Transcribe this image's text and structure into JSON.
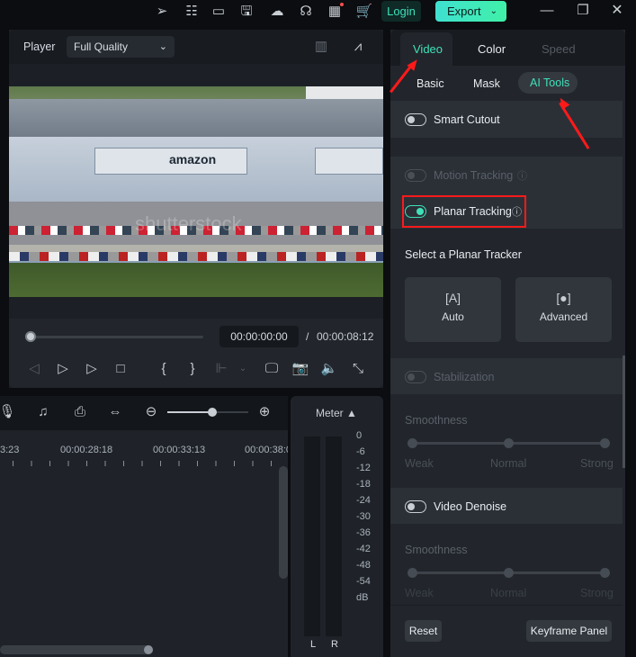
{
  "topbar": {
    "icons": [
      "send-icon",
      "task-icon",
      "layout-icon",
      "save-icon",
      "cloud-icon",
      "headset-icon",
      "apps-icon",
      "cart-icon"
    ],
    "login": "Login",
    "export": "Export",
    "window": [
      "minimize-icon",
      "restore-icon",
      "close-icon"
    ]
  },
  "player": {
    "label": "Player",
    "quality": "Full Quality",
    "current_time": "00:00:00:00",
    "separator": "/",
    "total_time": "00:00:08:12",
    "playback_progress": 0,
    "video_logo": "amazon",
    "watermark": "shutterstock"
  },
  "timeline": {
    "ruler": [
      "3:23",
      "00:00:28:18",
      "00:00:33:13",
      "00:00:38:0"
    ],
    "zoom_level": 0.55
  },
  "meter": {
    "title": "Meter ▲",
    "scale": [
      "0",
      "-6",
      "-12",
      "-18",
      "-24",
      "-30",
      "-36",
      "-42",
      "-48",
      "-54",
      "dB"
    ],
    "channels": [
      "L",
      "R"
    ]
  },
  "panel": {
    "tabs": [
      "Video",
      "Color",
      "Speed"
    ],
    "active_tab": "Video",
    "subtabs": [
      "Basic",
      "Mask",
      "AI Tools"
    ],
    "active_subtab": "AI Tools",
    "smart_cutout": "Smart Cutout",
    "motion_tracking": "Motion Tracking",
    "planar_tracking": "Planar Tracking",
    "select_tracker": "Select a Planar Tracker",
    "auto": "Auto",
    "advanced": "Advanced",
    "stabilization": "Stabilization",
    "smoothness": "Smoothness",
    "weak": "Weak",
    "normal": "Normal",
    "strong": "Strong",
    "video_denoise": "Video Denoise",
    "reset": "Reset",
    "keyframe_panel": "Keyframe Panel"
  },
  "colors": {
    "accent": "#3fe0b8",
    "annotation": "#ff1a1a"
  }
}
